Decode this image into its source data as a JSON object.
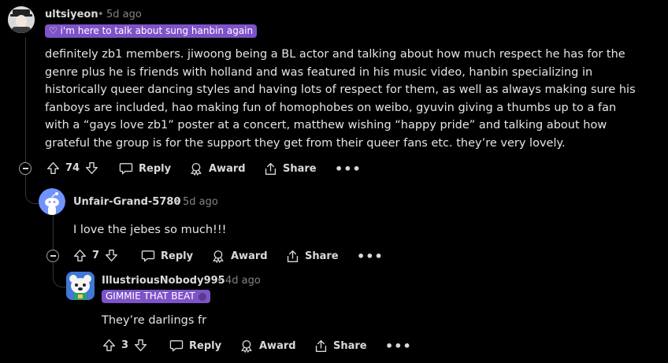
{
  "comments": [
    {
      "username": "ultsiyeon",
      "age": "5d ago",
      "flair": "♡ i'm here to talk about sung hanbin again",
      "body": "definitely zb1 members. jiwoong being a BL actor and talking about how much respect he has for the genre plus he is friends with holland and was featured in his music video, hanbin specializing in historically queer dancing styles and having lots of respect for them, as well as always making sure his fanboys are included, hao making fun of homophobes on weibo, gyuvin giving a thumbs up to a fan with a “gays love zb1” poster at a concert, matthew wishing “happy pride” and talking about how grateful the group is for the support they get from their queer fans etc. they’re very lovely.",
      "votes": "74"
    },
    {
      "username": "Unfair-Grand-5780",
      "age": "5d ago",
      "body": "I love the jebes so much!!!",
      "votes": "7"
    },
    {
      "username": "IllustriousNobody995",
      "age": "4d ago",
      "flair": "GIMMIE THAT BEAT",
      "body": "They’re darlings fr",
      "votes": "3"
    }
  ],
  "actions": {
    "reply": "Reply",
    "award": "Award",
    "share": "Share",
    "more": "•••",
    "dot": "•"
  },
  "colors": {
    "background": "#000000",
    "flair_purple": "#7e53c9",
    "text": "#d7dadc",
    "muted": "#818384",
    "thread_line": "#343536",
    "avatar_blue": "#7193ff"
  },
  "icons": [
    "upvote-icon",
    "downvote-icon",
    "comment-icon",
    "award-icon",
    "share-icon",
    "collapse-icon",
    "more-icon"
  ]
}
